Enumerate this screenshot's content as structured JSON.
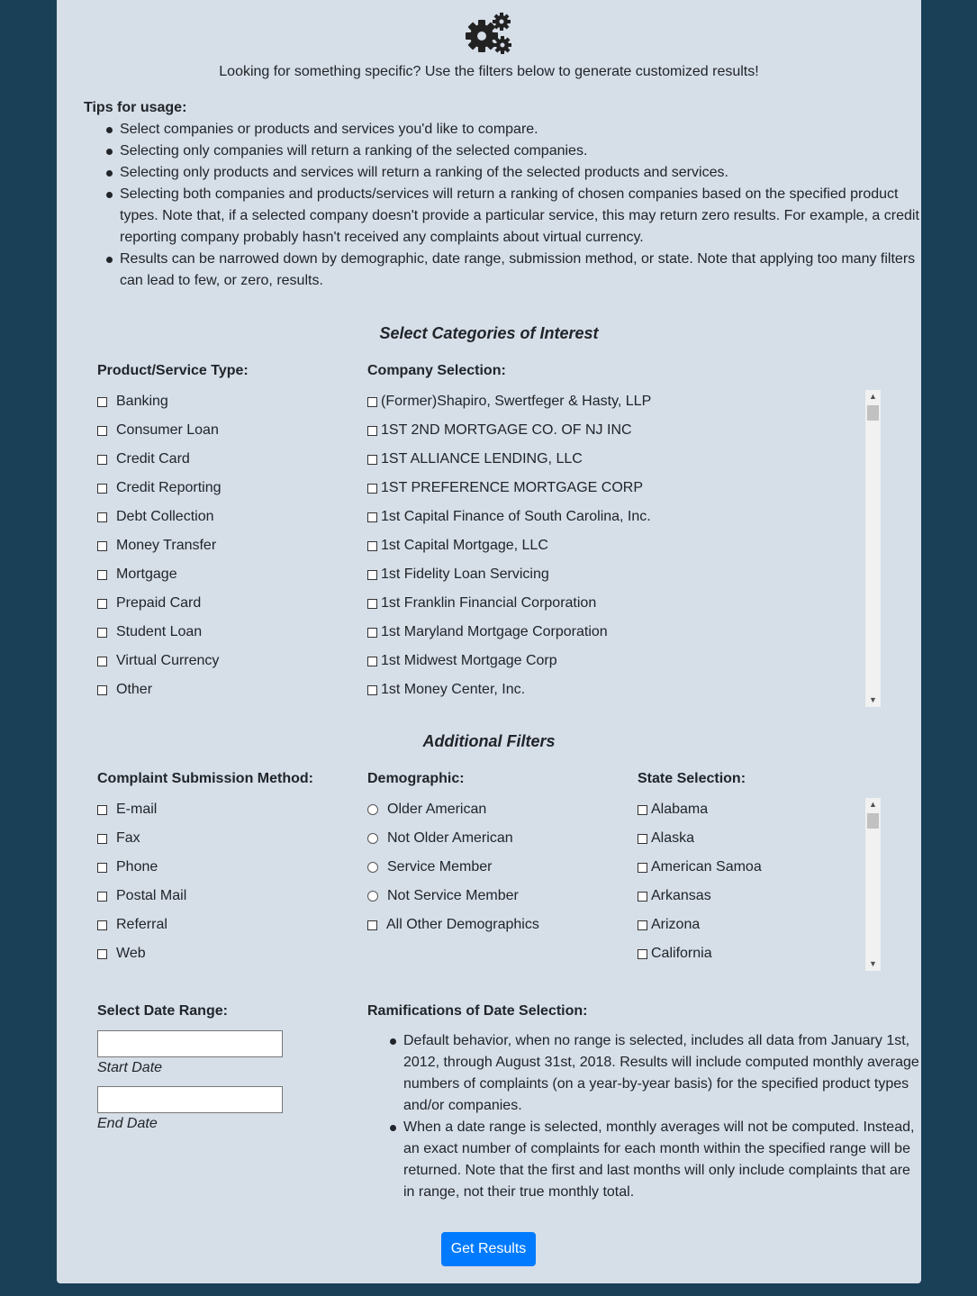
{
  "header": {
    "icon": "cogs-icon",
    "intro": "Looking for something specific? Use the filters below to generate customized results!"
  },
  "tips": {
    "title": "Tips for usage:",
    "items": [
      "Select companies or products and services you'd like to compare.",
      "Selecting only companies will return a ranking of the selected companies.",
      "Selecting only products and services will return a ranking of the selected products and services.",
      "Selecting both companies and products/services will return a ranking of chosen companies based on the specified product types. Note that, if a selected company doesn't provide a particular service, this may return zero results. For example, a credit reporting company probably hasn't received any complaints about virtual currency.",
      "Results can be narrowed down by demographic, date range, submission method, or state. Note that applying too many filters can lead to few, or zero, results."
    ]
  },
  "categories": {
    "title": "Select Categories of Interest",
    "product_title": "Product/Service Type:",
    "products": [
      "Banking",
      "Consumer Loan",
      "Credit Card",
      "Credit Reporting",
      "Debt Collection",
      "Money Transfer",
      "Mortgage",
      "Prepaid Card",
      "Student Loan",
      "Virtual Currency",
      "Other"
    ],
    "company_title": "Company Selection:",
    "companies": [
      "(Former)Shapiro, Swertfeger & Hasty, LLP",
      "1ST 2ND MORTGAGE CO. OF NJ INC",
      "1ST ALLIANCE LENDING, LLC",
      "1ST PREFERENCE MORTGAGE CORP",
      "1st Capital Finance of South Carolina, Inc.",
      "1st Capital Mortgage, LLC",
      "1st Fidelity Loan Servicing",
      "1st Franklin Financial Corporation",
      "1st Maryland Mortgage Corporation",
      "1st Midwest Mortgage Corp",
      "1st Money Center, Inc."
    ]
  },
  "filters": {
    "title": "Additional Filters",
    "method_title": "Complaint Submission Method:",
    "methods": [
      "E-mail",
      "Fax",
      "Phone",
      "Postal Mail",
      "Referral",
      "Web"
    ],
    "demo_title": "Demographic:",
    "demographics_radio": [
      "Older American",
      "Not Older American",
      "Service Member",
      "Not Service Member"
    ],
    "demographics_check": "All Other Demographics",
    "state_title": "State Selection:",
    "states": [
      "Alabama",
      "Alaska",
      "American Samoa",
      "Arkansas",
      "Arizona",
      "California"
    ]
  },
  "dates": {
    "title": "Select Date Range:",
    "start_label": "Start Date",
    "end_label": "End Date",
    "start_value": "",
    "end_value": "",
    "ram_title": "Ramifications of Date Selection:",
    "ram_items": [
      "Default behavior, when no range is selected, includes all data from January 1st, 2012, through August 31st, 2018. Results will include computed monthly average numbers of complaints (on a year-by-year basis) for the specified product types and/or companies.",
      "When a date range is selected, monthly averages will not be computed. Instead, an exact number of complaints for each month within the specified range will be returned. Note that the first and last months will only include complaints that are in range, not their true monthly total."
    ]
  },
  "submit_label": "Get Results",
  "colors": {
    "background": "#1a4058",
    "panel": "#d6dee8",
    "button": "#007bff"
  }
}
